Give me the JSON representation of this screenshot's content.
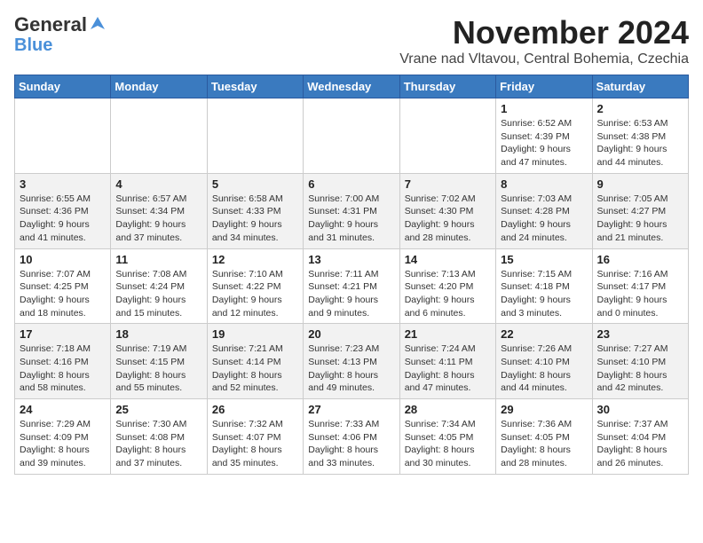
{
  "header": {
    "logo_line1": "General",
    "logo_line2": "Blue",
    "month": "November 2024",
    "location": "Vrane nad Vltavou, Central Bohemia, Czechia"
  },
  "weekdays": [
    "Sunday",
    "Monday",
    "Tuesday",
    "Wednesday",
    "Thursday",
    "Friday",
    "Saturday"
  ],
  "weeks": [
    [
      {
        "day": "",
        "info": ""
      },
      {
        "day": "",
        "info": ""
      },
      {
        "day": "",
        "info": ""
      },
      {
        "day": "",
        "info": ""
      },
      {
        "day": "",
        "info": ""
      },
      {
        "day": "1",
        "info": "Sunrise: 6:52 AM\nSunset: 4:39 PM\nDaylight: 9 hours and 47 minutes."
      },
      {
        "day": "2",
        "info": "Sunrise: 6:53 AM\nSunset: 4:38 PM\nDaylight: 9 hours and 44 minutes."
      }
    ],
    [
      {
        "day": "3",
        "info": "Sunrise: 6:55 AM\nSunset: 4:36 PM\nDaylight: 9 hours and 41 minutes."
      },
      {
        "day": "4",
        "info": "Sunrise: 6:57 AM\nSunset: 4:34 PM\nDaylight: 9 hours and 37 minutes."
      },
      {
        "day": "5",
        "info": "Sunrise: 6:58 AM\nSunset: 4:33 PM\nDaylight: 9 hours and 34 minutes."
      },
      {
        "day": "6",
        "info": "Sunrise: 7:00 AM\nSunset: 4:31 PM\nDaylight: 9 hours and 31 minutes."
      },
      {
        "day": "7",
        "info": "Sunrise: 7:02 AM\nSunset: 4:30 PM\nDaylight: 9 hours and 28 minutes."
      },
      {
        "day": "8",
        "info": "Sunrise: 7:03 AM\nSunset: 4:28 PM\nDaylight: 9 hours and 24 minutes."
      },
      {
        "day": "9",
        "info": "Sunrise: 7:05 AM\nSunset: 4:27 PM\nDaylight: 9 hours and 21 minutes."
      }
    ],
    [
      {
        "day": "10",
        "info": "Sunrise: 7:07 AM\nSunset: 4:25 PM\nDaylight: 9 hours and 18 minutes."
      },
      {
        "day": "11",
        "info": "Sunrise: 7:08 AM\nSunset: 4:24 PM\nDaylight: 9 hours and 15 minutes."
      },
      {
        "day": "12",
        "info": "Sunrise: 7:10 AM\nSunset: 4:22 PM\nDaylight: 9 hours and 12 minutes."
      },
      {
        "day": "13",
        "info": "Sunrise: 7:11 AM\nSunset: 4:21 PM\nDaylight: 9 hours and 9 minutes."
      },
      {
        "day": "14",
        "info": "Sunrise: 7:13 AM\nSunset: 4:20 PM\nDaylight: 9 hours and 6 minutes."
      },
      {
        "day": "15",
        "info": "Sunrise: 7:15 AM\nSunset: 4:18 PM\nDaylight: 9 hours and 3 minutes."
      },
      {
        "day": "16",
        "info": "Sunrise: 7:16 AM\nSunset: 4:17 PM\nDaylight: 9 hours and 0 minutes."
      }
    ],
    [
      {
        "day": "17",
        "info": "Sunrise: 7:18 AM\nSunset: 4:16 PM\nDaylight: 8 hours and 58 minutes."
      },
      {
        "day": "18",
        "info": "Sunrise: 7:19 AM\nSunset: 4:15 PM\nDaylight: 8 hours and 55 minutes."
      },
      {
        "day": "19",
        "info": "Sunrise: 7:21 AM\nSunset: 4:14 PM\nDaylight: 8 hours and 52 minutes."
      },
      {
        "day": "20",
        "info": "Sunrise: 7:23 AM\nSunset: 4:13 PM\nDaylight: 8 hours and 49 minutes."
      },
      {
        "day": "21",
        "info": "Sunrise: 7:24 AM\nSunset: 4:11 PM\nDaylight: 8 hours and 47 minutes."
      },
      {
        "day": "22",
        "info": "Sunrise: 7:26 AM\nSunset: 4:10 PM\nDaylight: 8 hours and 44 minutes."
      },
      {
        "day": "23",
        "info": "Sunrise: 7:27 AM\nSunset: 4:10 PM\nDaylight: 8 hours and 42 minutes."
      }
    ],
    [
      {
        "day": "24",
        "info": "Sunrise: 7:29 AM\nSunset: 4:09 PM\nDaylight: 8 hours and 39 minutes."
      },
      {
        "day": "25",
        "info": "Sunrise: 7:30 AM\nSunset: 4:08 PM\nDaylight: 8 hours and 37 minutes."
      },
      {
        "day": "26",
        "info": "Sunrise: 7:32 AM\nSunset: 4:07 PM\nDaylight: 8 hours and 35 minutes."
      },
      {
        "day": "27",
        "info": "Sunrise: 7:33 AM\nSunset: 4:06 PM\nDaylight: 8 hours and 33 minutes."
      },
      {
        "day": "28",
        "info": "Sunrise: 7:34 AM\nSunset: 4:05 PM\nDaylight: 8 hours and 30 minutes."
      },
      {
        "day": "29",
        "info": "Sunrise: 7:36 AM\nSunset: 4:05 PM\nDaylight: 8 hours and 28 minutes."
      },
      {
        "day": "30",
        "info": "Sunrise: 7:37 AM\nSunset: 4:04 PM\nDaylight: 8 hours and 26 minutes."
      }
    ]
  ]
}
